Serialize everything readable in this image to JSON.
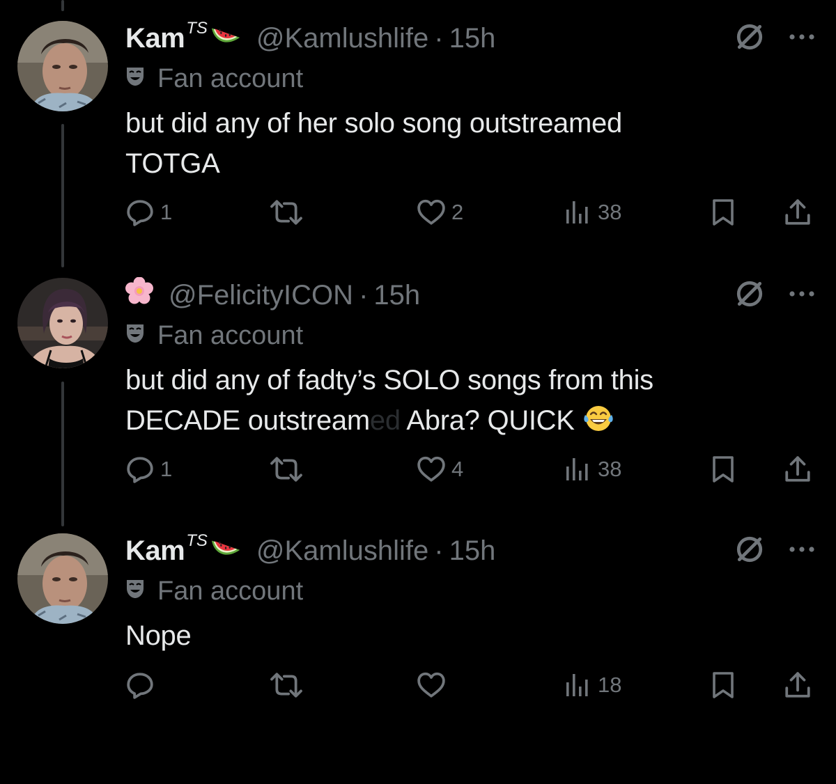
{
  "colors": {
    "background": "#000000",
    "text_primary": "#e7e9ea",
    "text_secondary": "#71767b",
    "thread_line": "#333639"
  },
  "tweets": [
    {
      "name": "Kam",
      "name_suffix": "TS",
      "name_emoji": "watermelon",
      "handle": "@Kamlushlife",
      "separator": "·",
      "time": "15h",
      "badge_icon": "theater-mask-icon",
      "badge_text": "Fan account",
      "text_line1": "but did any of her solo song outstreamed",
      "text_line2": "TOTGA",
      "replies": "1",
      "reposts": "",
      "likes": "2",
      "views": "38"
    },
    {
      "name_emoji": "cherry-blossom",
      "handle": "@FelicityICON",
      "separator": "·",
      "time": "15h",
      "badge_icon": "theater-mask-icon",
      "badge_text": "Fan account",
      "text_line1": "but did any of fadty’s SOLO songs from this",
      "text_line2": "DECADE outstream",
      "text_faded": "ed",
      "text_line2_end": " Abra? QUICK",
      "text_emoji": "face-with-tears-of-joy",
      "replies": "1",
      "reposts": "",
      "likes": "4",
      "views": "38"
    },
    {
      "name": "Kam",
      "name_suffix": "TS",
      "name_emoji": "watermelon",
      "handle": "@Kamlushlife",
      "separator": "·",
      "time": "15h",
      "badge_icon": "theater-mask-icon",
      "badge_text": "Fan account",
      "text_line1": "Nope",
      "replies": "",
      "reposts": "",
      "likes": "",
      "views": "18"
    }
  ]
}
